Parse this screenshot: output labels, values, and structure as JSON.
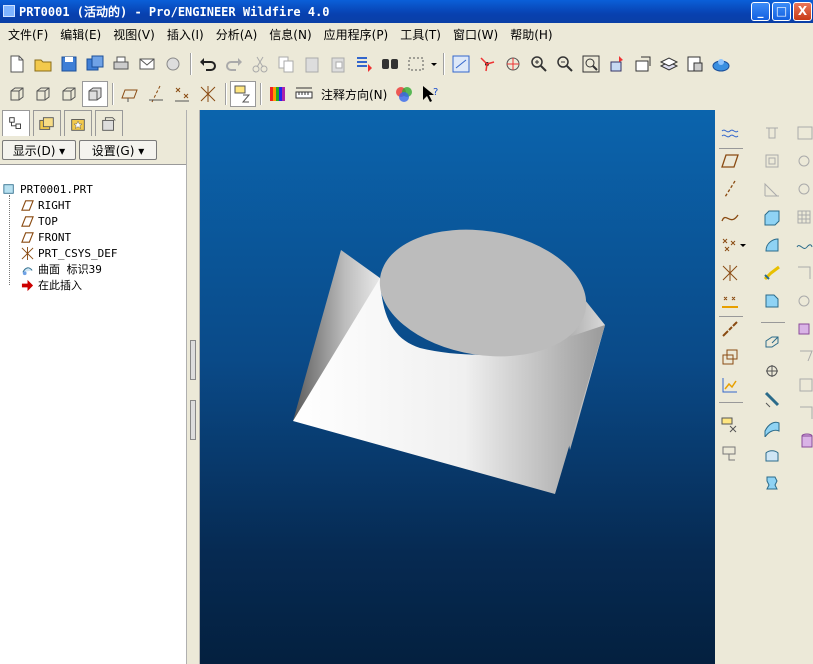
{
  "window": {
    "title": "PRT0001 (活动的) - Pro/ENGINEER Wildfire 4.0",
    "minimize": "_",
    "maximize": "□",
    "close": "X"
  },
  "menu": [
    "文件(F)",
    "编辑(E)",
    "视图(V)",
    "插入(I)",
    "分析(A)",
    "信息(N)",
    "应用程序(P)",
    "工具(T)",
    "窗口(W)",
    "帮助(H)"
  ],
  "toolbar2": {
    "annotation_orientation": "注释方向(N)"
  },
  "panel": {
    "display_dropdown": "显示(D) ▾",
    "settings_dropdown": "设置(G) ▾"
  },
  "model_tree": {
    "root": "PRT0001.PRT",
    "items": [
      "RIGHT",
      "TOP",
      "FRONT",
      "PRT_CSYS_DEF",
      "曲面 标识39",
      "在此插入"
    ]
  },
  "colors": {
    "title_bar": "#0a5fd8",
    "viewport_top": "#0b64ad",
    "viewport_bottom": "#04203f",
    "insert_arrow": "#cc0000",
    "datum_plane": "#8a4b12"
  }
}
